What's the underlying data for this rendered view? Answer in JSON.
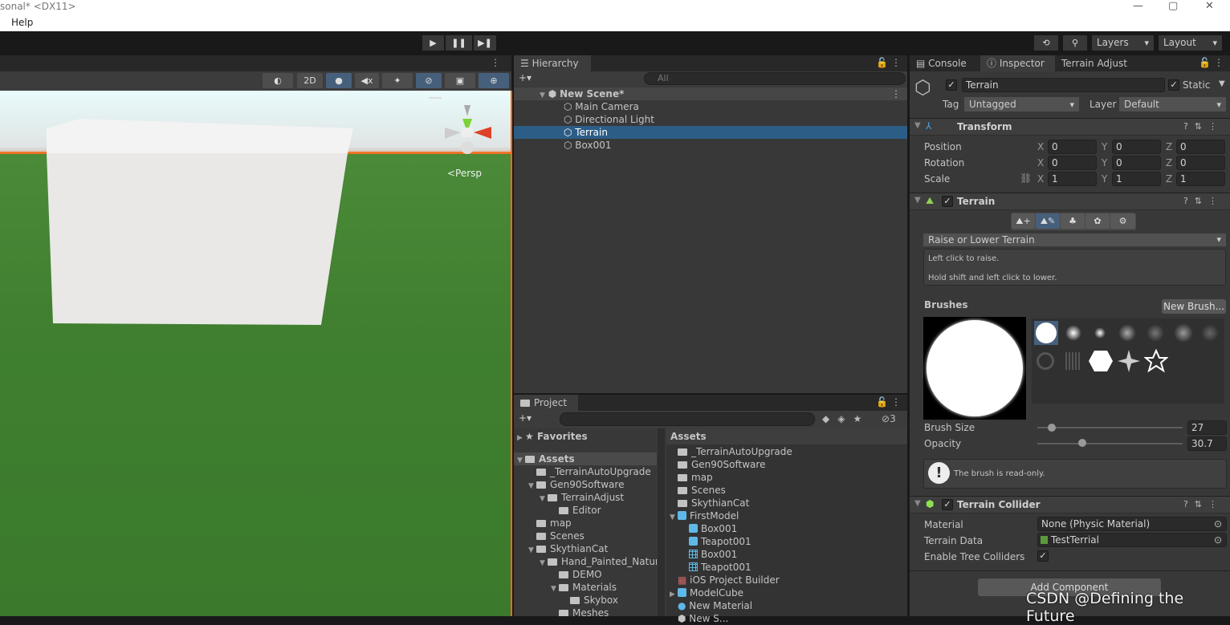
{
  "window": {
    "title": "sonal* <DX11>",
    "menu": [
      "Help"
    ],
    "controls": [
      "—",
      "▢",
      "✕"
    ]
  },
  "toolbar": {
    "play": "▶",
    "pause": "❚❚",
    "step": "▶❚",
    "history_icon": "history-icon",
    "search_icon": "search-icon",
    "layers": "Layers",
    "layout": "Layout"
  },
  "scene": {
    "menu_dots": "⋮",
    "buttons": {
      "shading": "◐",
      "mode_2d": "2D",
      "lighting": "💡",
      "audio": "🔇",
      "effects": "✦",
      "hidden": "⊘",
      "camera": "▣",
      "gizmos": "⊕"
    },
    "persp_label": "<Persp",
    "accent": "#ff6a1a"
  },
  "hierarchy": {
    "tab": "Hierarchy",
    "add": "+▾",
    "search_placeholder": "All",
    "scene_name": "New Scene*",
    "items": [
      "Main Camera",
      "Directional Light",
      "Terrain",
      "Box001"
    ],
    "selected": "Terrain",
    "selection_color": "#2c5d87"
  },
  "project": {
    "tab": "Project",
    "add": "+▾",
    "hidden_count": "3",
    "tree": [
      {
        "label": "Favorites",
        "depth": 0,
        "tri": "▶",
        "icon": "star"
      },
      {
        "label": "Assets",
        "depth": 0,
        "tri": "▼",
        "icon": "folder-open"
      },
      {
        "label": "_TerrainAutoUpgrade",
        "depth": 1,
        "tri": "",
        "icon": "folder"
      },
      {
        "label": "Gen90Software",
        "depth": 1,
        "tri": "▼",
        "icon": "folder-open"
      },
      {
        "label": "TerrainAdjust",
        "depth": 2,
        "tri": "▼",
        "icon": "folder-open"
      },
      {
        "label": "Editor",
        "depth": 3,
        "tri": "",
        "icon": "folder"
      },
      {
        "label": "map",
        "depth": 1,
        "tri": "",
        "icon": "folder"
      },
      {
        "label": "Scenes",
        "depth": 1,
        "tri": "",
        "icon": "folder"
      },
      {
        "label": "SkythianCat",
        "depth": 1,
        "tri": "▼",
        "icon": "folder-open"
      },
      {
        "label": "Hand_Painted_Natur",
        "depth": 2,
        "tri": "▼",
        "icon": "folder-open"
      },
      {
        "label": "DEMO",
        "depth": 3,
        "tri": "",
        "icon": "folder"
      },
      {
        "label": "Materials",
        "depth": 3,
        "tri": "▼",
        "icon": "folder-open"
      },
      {
        "label": "Skybox",
        "depth": 4,
        "tri": "",
        "icon": "folder"
      },
      {
        "label": "Meshes",
        "depth": 3,
        "tri": "",
        "icon": "folder"
      }
    ],
    "assets_header": "Assets",
    "assets": [
      {
        "label": "_TerrainAutoUpgrade",
        "depth": 0,
        "tri": "",
        "icon": "folder"
      },
      {
        "label": "Gen90Software",
        "depth": 0,
        "tri": "",
        "icon": "folder"
      },
      {
        "label": "map",
        "depth": 0,
        "tri": "",
        "icon": "folder"
      },
      {
        "label": "Scenes",
        "depth": 0,
        "tri": "",
        "icon": "folder"
      },
      {
        "label": "SkythianCat",
        "depth": 0,
        "tri": "",
        "icon": "folder"
      },
      {
        "label": "FirstModel",
        "depth": 0,
        "tri": "▼",
        "icon": "model"
      },
      {
        "label": "Box001",
        "depth": 1,
        "tri": "",
        "icon": "model"
      },
      {
        "label": "Teapot001",
        "depth": 1,
        "tri": "",
        "icon": "model"
      },
      {
        "label": "Box001",
        "depth": 1,
        "tri": "",
        "icon": "mesh"
      },
      {
        "label": "Teapot001",
        "depth": 1,
        "tri": "",
        "icon": "mesh"
      },
      {
        "label": "iOS Project Builder",
        "depth": 0,
        "tri": "",
        "icon": "package"
      },
      {
        "label": "ModelCube",
        "depth": 0,
        "tri": "▶",
        "icon": "model"
      },
      {
        "label": "New Material",
        "depth": 0,
        "tri": "",
        "icon": "material"
      },
      {
        "label": "New S...",
        "depth": 0,
        "tri": "",
        "icon": "scene"
      }
    ]
  },
  "inspector": {
    "tabs": [
      "Console",
      "Inspector",
      "Terrain Adjust"
    ],
    "object": {
      "name": "Terrain",
      "active": true,
      "static_label": "Static",
      "static": true,
      "tag_label": "Tag",
      "tag": "Untagged",
      "layer_label": "Layer",
      "layer": "Default"
    },
    "transform": {
      "title": "Transform",
      "rows": [
        {
          "label": "Position",
          "x": "0",
          "y": "0",
          "z": "0"
        },
        {
          "label": "Rotation",
          "x": "0",
          "y": "0",
          "z": "0"
        },
        {
          "label": "Scale",
          "x": "1",
          "y": "1",
          "z": "1"
        }
      ]
    },
    "terrain": {
      "title": "Terrain",
      "tool": "Raise or Lower Terrain",
      "help1": "Left click to raise.",
      "help2": "Hold shift and left click to lower.",
      "brushes_label": "Brushes",
      "new_brush": "New Brush...",
      "brush_size_label": "Brush Size",
      "brush_size": "27",
      "brush_size_fraction": 0.1,
      "opacity_label": "Opacity",
      "opacity": "30.7",
      "opacity_fraction": 0.31,
      "readonly_msg": "The brush is read-only."
    },
    "collider": {
      "title": "Terrain Collider",
      "material_label": "Material",
      "material": "None (Physic Material)",
      "data_label": "Terrain Data",
      "data": "TestTerrial",
      "trees_label": "Enable Tree Colliders",
      "trees": true
    },
    "add_component": "Add Component"
  },
  "watermark": "CSDN @Defining the Future"
}
